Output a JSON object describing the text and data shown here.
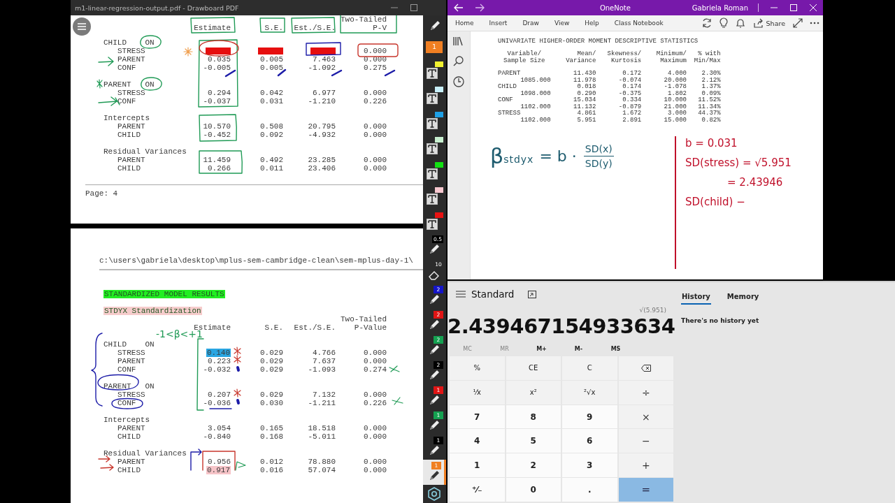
{
  "pdf_viewer": {
    "title": "m1-linear-regression-output.pdf - Drawboard PDF",
    "top_page": {
      "columns": [
        {
          "label": "Estimate"
        },
        {
          "label": "S.E."
        },
        {
          "label": "Est./S.E."
        },
        {
          "top": "Two-Tailed",
          "label": "P-V"
        }
      ],
      "sections": [
        {
          "title": "CHILD",
          "keyword": "ON",
          "rows": [
            {
              "label": "STRESS",
              "cells": [
                {
                  "covered": true
                },
                {
                  "covered": true
                },
                {
                  "covered": true
                },
                {
                  "value": "0.000"
                }
              ]
            },
            {
              "label": "PARENT",
              "cells": [
                {
                  "value": "0.035"
                },
                {
                  "value": "0.005"
                },
                {
                  "value": "7.463"
                },
                {
                  "value": "0.000"
                }
              ]
            },
            {
              "label": "CONF",
              "cells": [
                {
                  "value": "-0.005"
                },
                {
                  "value": "0.005"
                },
                {
                  "value": "-1.092"
                },
                {
                  "value": "0.275"
                }
              ]
            }
          ]
        },
        {
          "title": "PARENT",
          "keyword": "ON",
          "rows": [
            {
              "label": "STRESS",
              "cells": [
                {
                  "value": "0.294"
                },
                {
                  "value": "0.042"
                },
                {
                  "value": "6.977"
                },
                {
                  "value": "0.000"
                }
              ]
            },
            {
              "label": "CONF",
              "cells": [
                {
                  "value": "-0.037"
                },
                {
                  "value": "0.031"
                },
                {
                  "value": "-1.210"
                },
                {
                  "value": "0.226"
                }
              ]
            }
          ]
        },
        {
          "title": "Intercepts",
          "rows": [
            {
              "label": "PARENT",
              "cells": [
                {
                  "value": "10.570"
                },
                {
                  "value": "0.508"
                },
                {
                  "value": "20.795"
                },
                {
                  "value": "0.000"
                }
              ]
            },
            {
              "label": "CHILD",
              "cells": [
                {
                  "value": "-0.452"
                },
                {
                  "value": "0.092"
                },
                {
                  "value": "-4.932"
                },
                {
                  "value": "0.000"
                }
              ]
            }
          ]
        },
        {
          "title": "Residual Variances",
          "rows": [
            {
              "label": "PARENT",
              "cells": [
                {
                  "value": "11.459"
                },
                {
                  "value": "0.492"
                },
                {
                  "value": "23.285"
                },
                {
                  "value": "0.000"
                }
              ]
            },
            {
              "label": "CHILD",
              "cells": [
                {
                  "value": "0.266"
                },
                {
                  "value": "0.011"
                },
                {
                  "value": "23.406"
                },
                {
                  "value": "0.000"
                }
              ]
            }
          ]
        }
      ],
      "footer": "Page: 4"
    },
    "bottom_page": {
      "path": "c:\\users\\gabriela\\desktop\\mplus-sem-cambridge-clean\\sem-mplus-day-1\\",
      "headings": [
        {
          "text": "STANDARDIZED MODEL RESULTS",
          "color": "#22ee22"
        },
        {
          "text": "STDYX Standardization",
          "color": "#f6cccc"
        }
      ],
      "columns": [
        {
          "label": "Estimate"
        },
        {
          "label": "S.E."
        },
        {
          "label": "Est./S.E."
        },
        {
          "top": "Two-Tailed",
          "label": "P-Value"
        }
      ],
      "ink_note": "-1<β<+1",
      "sections": [
        {
          "title": "CHILD",
          "keyword": "ON",
          "rows": [
            {
              "label": "STRESS",
              "cells": [
                {
                  "value": "0.140",
                  "color": "#2aa6e2"
                },
                {
                  "value": "0.029"
                },
                {
                  "value": "4.766"
                },
                {
                  "value": "0.000"
                }
              ]
            },
            {
              "label": "PARENT",
              "cells": [
                {
                  "value": "0.223"
                },
                {
                  "value": "0.029"
                },
                {
                  "value": "7.637"
                },
                {
                  "value": "0.000"
                }
              ]
            },
            {
              "label": "CONF",
              "cells": [
                {
                  "value": "-0.032"
                },
                {
                  "value": "0.029"
                },
                {
                  "value": "-1.093"
                },
                {
                  "value": "0.274"
                }
              ]
            }
          ]
        },
        {
          "title": "PARENT",
          "keyword": "ON",
          "rows": [
            {
              "label": "STRESS",
              "cells": [
                {
                  "value": "0.207"
                },
                {
                  "value": "0.029"
                },
                {
                  "value": "7.132"
                },
                {
                  "value": "0.000"
                }
              ]
            },
            {
              "label": "CONF",
              "cells": [
                {
                  "value": "-0.036"
                },
                {
                  "value": "0.030"
                },
                {
                  "value": "-1.211"
                },
                {
                  "value": "0.226"
                }
              ]
            }
          ]
        },
        {
          "title": "Intercepts",
          "rows": [
            {
              "label": "PARENT",
              "cells": [
                {
                  "value": "3.054"
                },
                {
                  "value": "0.165"
                },
                {
                  "value": "18.518"
                },
                {
                  "value": "0.000"
                }
              ]
            },
            {
              "label": "CHILD",
              "cells": [
                {
                  "value": "-0.840"
                },
                {
                  "value": "0.168"
                },
                {
                  "value": "-5.011"
                },
                {
                  "value": "0.000"
                }
              ]
            }
          ]
        },
        {
          "title": "Residual Variances",
          "rows": [
            {
              "label": "PARENT",
              "cells": [
                {
                  "value": "0.956"
                },
                {
                  "value": "0.012"
                },
                {
                  "value": "78.880"
                },
                {
                  "value": "0.000"
                }
              ]
            },
            {
              "label": "CHILD",
              "cells": [
                {
                  "value": "0.917",
                  "color": "#f6c4c8"
                },
                {
                  "value": "0.016"
                },
                {
                  "value": "57.074"
                },
                {
                  "value": "0.000"
                }
              ]
            }
          ]
        }
      ]
    },
    "tools": [
      {
        "kind": "pen",
        "selected": false
      },
      {
        "kind": "swatch",
        "label": "1",
        "color": "#f07f22",
        "selected": false
      },
      {
        "kind": "text",
        "color": "#f2f230",
        "selected": false
      },
      {
        "kind": "text",
        "color": "#c8f0fa",
        "selected": false
      },
      {
        "kind": "text",
        "color": "#1ea0e6",
        "selected": false
      },
      {
        "kind": "text",
        "color": "#c8f0d0",
        "selected": false
      },
      {
        "kind": "text",
        "color": "#12e012",
        "selected": false
      },
      {
        "kind": "text",
        "color": "#f8c8d0",
        "selected": false
      },
      {
        "kind": "text",
        "color": "#e81212",
        "selected": false
      },
      {
        "kind": "pen",
        "label": "0.5",
        "color": "#000000",
        "selected": false
      },
      {
        "kind": "eraser",
        "label": "10",
        "selected": false
      },
      {
        "kind": "pen",
        "label": "2",
        "color": "#1414c8",
        "selected": false
      },
      {
        "kind": "pen",
        "label": "2",
        "color": "#e01414",
        "selected": false
      },
      {
        "kind": "pen",
        "label": "2",
        "color": "#14a050",
        "selected": false
      },
      {
        "kind": "pen",
        "label": "2",
        "color": "#000000",
        "selected": false
      },
      {
        "kind": "pen",
        "label": "1",
        "color": "#e01414",
        "selected": false
      },
      {
        "kind": "pen",
        "label": "1",
        "color": "#14a050",
        "selected": false
      },
      {
        "kind": "pen",
        "label": "1",
        "color": "#000000",
        "selected": false
      },
      {
        "kind": "pen",
        "label": "1",
        "color": "#f07f22",
        "selected": true
      },
      {
        "kind": "settings",
        "selected": false
      }
    ]
  },
  "onenote": {
    "title": "OneNote",
    "user": "Gabriela Roman",
    "ribbon_tabs": [
      "Home",
      "Insert",
      "Draw",
      "View",
      "Help",
      "Class Notebook"
    ],
    "share": "Share",
    "stats": {
      "title": "UNIVARIATE HIGHER-ORDER MOMENT DESCRIPTIVE STATISTICS",
      "columns": [
        {
          "top": "Variable/",
          "bottom": "Sample Size"
        },
        {
          "top": "Mean/",
          "bottom": "Variance"
        },
        {
          "top": "Skewness/",
          "bottom": "Kurtosis"
        },
        {
          "top": "Minimum/",
          "bottom": "Maximum"
        },
        {
          "top": "% with",
          "bottom": "Min/Max"
        }
      ],
      "rows": [
        {
          "name": "PARENT",
          "sample_size": "1085.000",
          "first": [
            "11.430",
            "0.172",
            "4.000",
            "2.30%"
          ],
          "second": [
            "11.978",
            "-0.074",
            "20.000",
            "2.12%"
          ]
        },
        {
          "name": "CHILD",
          "sample_size": "1098.000",
          "first": [
            "0.018",
            "0.174",
            "-1.078",
            "1.37%"
          ],
          "second": [
            "0.290",
            "-0.375",
            "1.802",
            "0.09%"
          ]
        },
        {
          "name": "CONF",
          "sample_size": "1102.000",
          "first": [
            "15.034",
            "0.334",
            "10.000",
            "11.52%"
          ],
          "second": [
            "11.132",
            "-0.879",
            "21.000",
            "11.34%"
          ]
        },
        {
          "name": "STRESS",
          "sample_size": "1102.000",
          "first": [
            "4.861",
            "1.672",
            "3.000",
            "44.37%"
          ],
          "second": [
            "5.951",
            "2.891",
            "15.000",
            "0.82%"
          ]
        }
      ]
    },
    "formula": {
      "lhs": "β",
      "subscript": "stdyx",
      "rhs": "= b ·",
      "numerator": "SD(x)",
      "denominator": "SD(y)"
    },
    "notes": [
      {
        "text": "b = 0.031",
        "kind": "line"
      },
      {
        "text": "SD(stress) = √5.951",
        "kind": "line"
      },
      {
        "text": "= 2.43946",
        "kind": "continuation"
      },
      {
        "text": "SD(child) −",
        "kind": "line"
      }
    ]
  },
  "calculator": {
    "mode": "Standard",
    "tabs": [
      {
        "label": "History",
        "selected": true
      },
      {
        "label": "Memory",
        "selected": false
      }
    ],
    "expression": "√(5.951)",
    "display": "2.439467154933634",
    "history_message": "There's no history yet",
    "memory_buttons": [
      {
        "label": "MC",
        "disabled": true
      },
      {
        "label": "MR",
        "disabled": true
      },
      {
        "label": "M+",
        "disabled": false
      },
      {
        "label": "M-",
        "disabled": false
      },
      {
        "label": "MS",
        "disabled": false
      }
    ],
    "keys": [
      {
        "label": "%",
        "kind": "function"
      },
      {
        "label": "CE",
        "kind": "function"
      },
      {
        "label": "C",
        "kind": "function"
      },
      {
        "kind": "backspace"
      },
      {
        "label": "¹⁄x",
        "kind": "function"
      },
      {
        "label": "x²",
        "kind": "function"
      },
      {
        "label": "²√x",
        "kind": "function"
      },
      {
        "label": "÷",
        "kind": "operator"
      },
      {
        "label": "7",
        "kind": "digit"
      },
      {
        "label": "8",
        "kind": "digit"
      },
      {
        "label": "9",
        "kind": "digit"
      },
      {
        "label": "×",
        "kind": "operator"
      },
      {
        "label": "4",
        "kind": "digit"
      },
      {
        "label": "5",
        "kind": "digit"
      },
      {
        "label": "6",
        "kind": "digit"
      },
      {
        "label": "−",
        "kind": "operator"
      },
      {
        "label": "1",
        "kind": "digit"
      },
      {
        "label": "2",
        "kind": "digit"
      },
      {
        "label": "3",
        "kind": "digit"
      },
      {
        "label": "+",
        "kind": "operator"
      },
      {
        "label": "⁺⁄₋",
        "kind": "digit"
      },
      {
        "label": "0",
        "kind": "digit"
      },
      {
        "label": ".",
        "kind": "digit"
      },
      {
        "label": "=",
        "kind": "equals"
      }
    ]
  }
}
